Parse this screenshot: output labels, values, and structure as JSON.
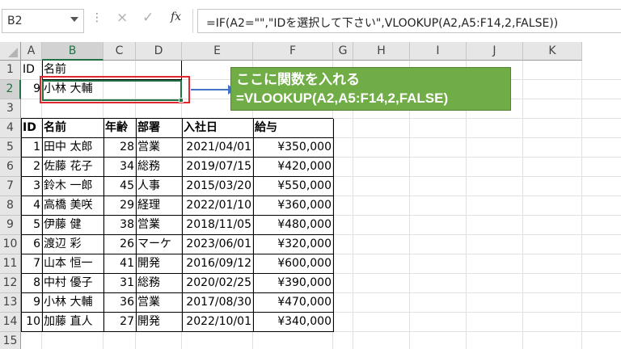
{
  "formula_bar": {
    "name_box": "B2",
    "cancel_icon": "×",
    "enter_icon": "✓",
    "fx_label": "fx",
    "formula": "=IF(A2=\"\",\"IDを選択して下さい\",VLOOKUP(A2,A5:F14,2,FALSE))"
  },
  "columns": [
    "A",
    "B",
    "C",
    "D",
    "E",
    "F",
    "G",
    "H",
    "I",
    "J",
    "K"
  ],
  "rows": [
    "1",
    "2",
    "3",
    "4",
    "5",
    "6",
    "7",
    "8",
    "9",
    "10",
    "11",
    "12",
    "13",
    "14",
    "15"
  ],
  "lookup": {
    "a1": "ID",
    "b1": "名前",
    "a2": "9",
    "b2": "小林 大輔"
  },
  "table": {
    "headers": [
      "ID",
      "名前",
      "年齢",
      "部署",
      "入社日",
      "給与"
    ],
    "rows": [
      [
        "1",
        "田中 太郎",
        "28",
        "営業",
        "2021/04/01",
        "¥350,000"
      ],
      [
        "2",
        "佐藤 花子",
        "34",
        "総務",
        "2019/07/15",
        "¥420,000"
      ],
      [
        "3",
        "鈴木 一郎",
        "45",
        "人事",
        "2015/03/20",
        "¥550,000"
      ],
      [
        "4",
        "高橋 美咲",
        "29",
        "経理",
        "2022/01/10",
        "¥360,000"
      ],
      [
        "5",
        "伊藤 健",
        "38",
        "営業",
        "2018/11/05",
        "¥480,000"
      ],
      [
        "6",
        "渡辺 彩",
        "26",
        "マーケ",
        "2023/06/01",
        "¥320,000"
      ],
      [
        "7",
        "山本 恒一",
        "41",
        "開発",
        "2016/09/12",
        "¥600,000"
      ],
      [
        "8",
        "中村 優子",
        "31",
        "総務",
        "2020/02/25",
        "¥390,000"
      ],
      [
        "9",
        "小林 大輔",
        "36",
        "営業",
        "2017/08/30",
        "¥470,000"
      ],
      [
        "10",
        "加藤 直人",
        "27",
        "開発",
        "2022/10/01",
        "¥340,000"
      ]
    ]
  },
  "callout": {
    "line1": "ここに関数を入れる",
    "line2": "=VLOOKUP(A2,A5:F14,2,FALSE)",
    "color": "#70ad47"
  },
  "accent_color": "#217346",
  "highlight_color": "#e0262f",
  "arrow_color": "#4472c4"
}
